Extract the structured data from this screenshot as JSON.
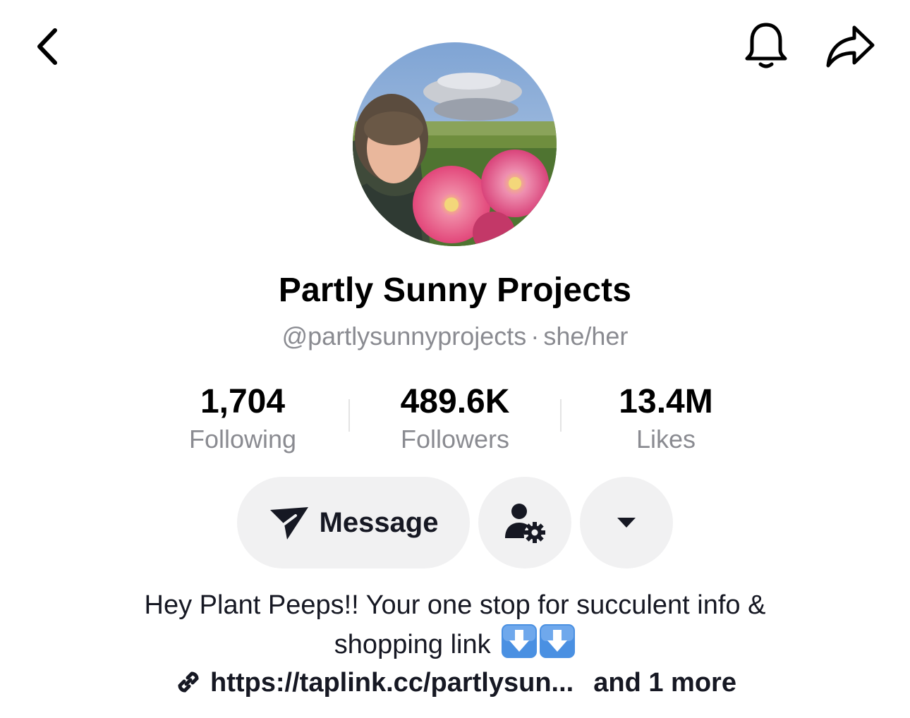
{
  "header": {
    "back_icon": "chevron-left-icon",
    "bell_icon": "bell-icon",
    "share_icon": "share-arrow-icon"
  },
  "profile": {
    "display_name": "Partly Sunny Projects",
    "handle": "@partlysunnyprojects",
    "separator": "·",
    "pronouns": "she/her"
  },
  "stats": [
    {
      "value": "1,704",
      "label": "Following"
    },
    {
      "value": "489.6K",
      "label": "Followers"
    },
    {
      "value": "13.4M",
      "label": "Likes"
    }
  ],
  "actions": {
    "message_label": "Message",
    "message_icon": "send-icon",
    "friends_icon": "user-settings-icon",
    "more_icon": "caret-down-icon"
  },
  "bio": {
    "line1": "Hey Plant Peeps!! Your one stop for succulent info &",
    "line2": "shopping link",
    "emoji": [
      "⬇️",
      "⬇️"
    ]
  },
  "link": {
    "url": "https://taplink.cc/partlysun...",
    "more": "and 1 more"
  },
  "colors": {
    "text_primary": "#161823",
    "text_secondary": "#8a8b91",
    "button_bg": "#f1f1f2",
    "emoji_blue": "#4a90e2"
  }
}
